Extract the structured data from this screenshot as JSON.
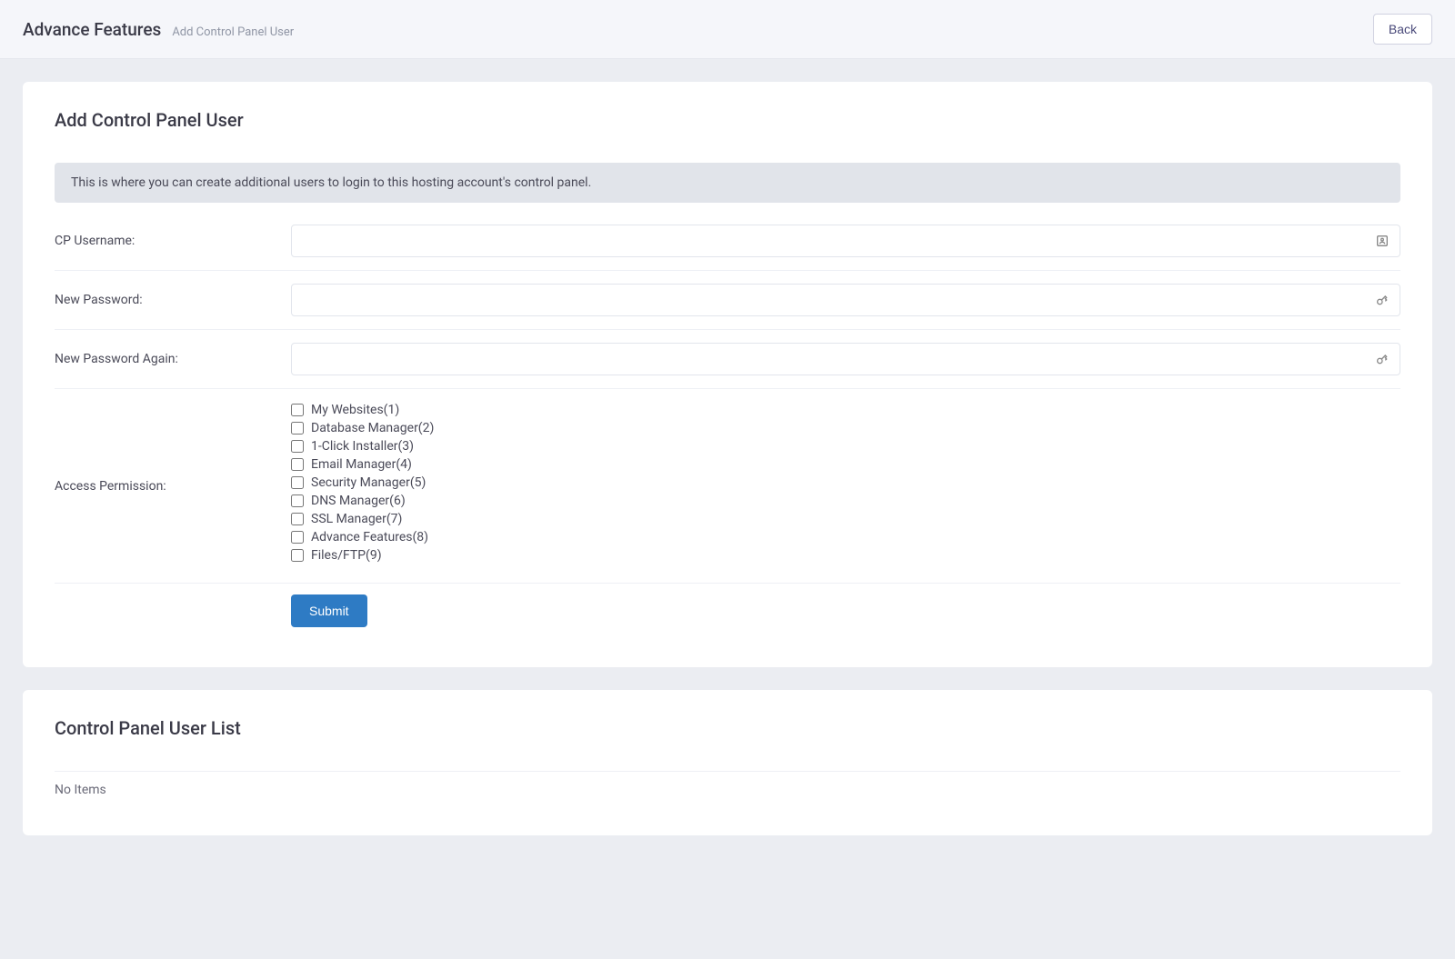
{
  "header": {
    "title": "Advance Features",
    "breadcrumb": "Add Control Panel User",
    "back_label": "Back"
  },
  "form_card": {
    "title": "Add Control Panel User",
    "info_banner": "This is where you can create additional users to login to this hosting account's control panel.",
    "labels": {
      "cp_username": "CP Username:",
      "new_password": "New Password:",
      "new_password_again": "New Password Again:",
      "access_permission": "Access Permission:"
    },
    "fields": {
      "cp_username": "",
      "new_password": "",
      "new_password_again": ""
    },
    "permissions": [
      "My Websites(1)",
      "Database Manager(2)",
      "1-Click Installer(3)",
      "Email Manager(4)",
      "Security Manager(5)",
      "DNS Manager(6)",
      "SSL Manager(7)",
      "Advance Features(8)",
      "Files/FTP(9)"
    ],
    "submit_label": "Submit"
  },
  "list_card": {
    "title": "Control Panel User List",
    "empty_text": "No Items"
  }
}
